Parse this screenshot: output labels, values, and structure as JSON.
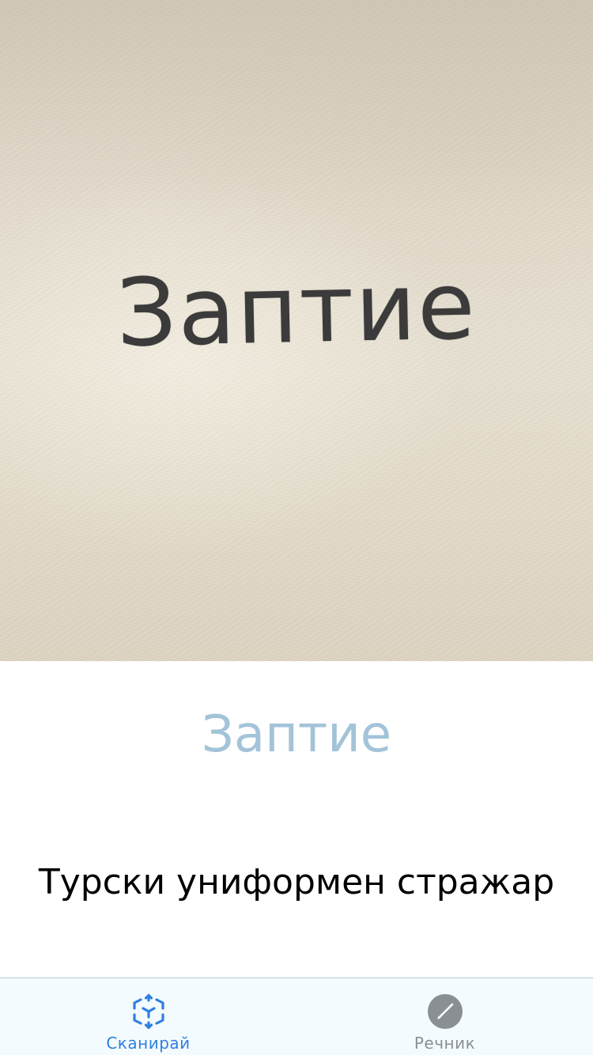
{
  "camera": {
    "detected_text": "Заптие"
  },
  "result": {
    "word": "Заптие",
    "translation": "Турски униформен стражар"
  },
  "tabs": [
    {
      "label": "Сканирай",
      "icon": "scan-icon",
      "active": true
    },
    {
      "label": "Речник",
      "icon": "pencil-icon",
      "active": false
    }
  ],
  "colors": {
    "accent": "#2f7fe0",
    "inactive": "#8a8f94",
    "result_word": "#a3c3d8",
    "tab_bar_bg": "#f3fbfe"
  }
}
